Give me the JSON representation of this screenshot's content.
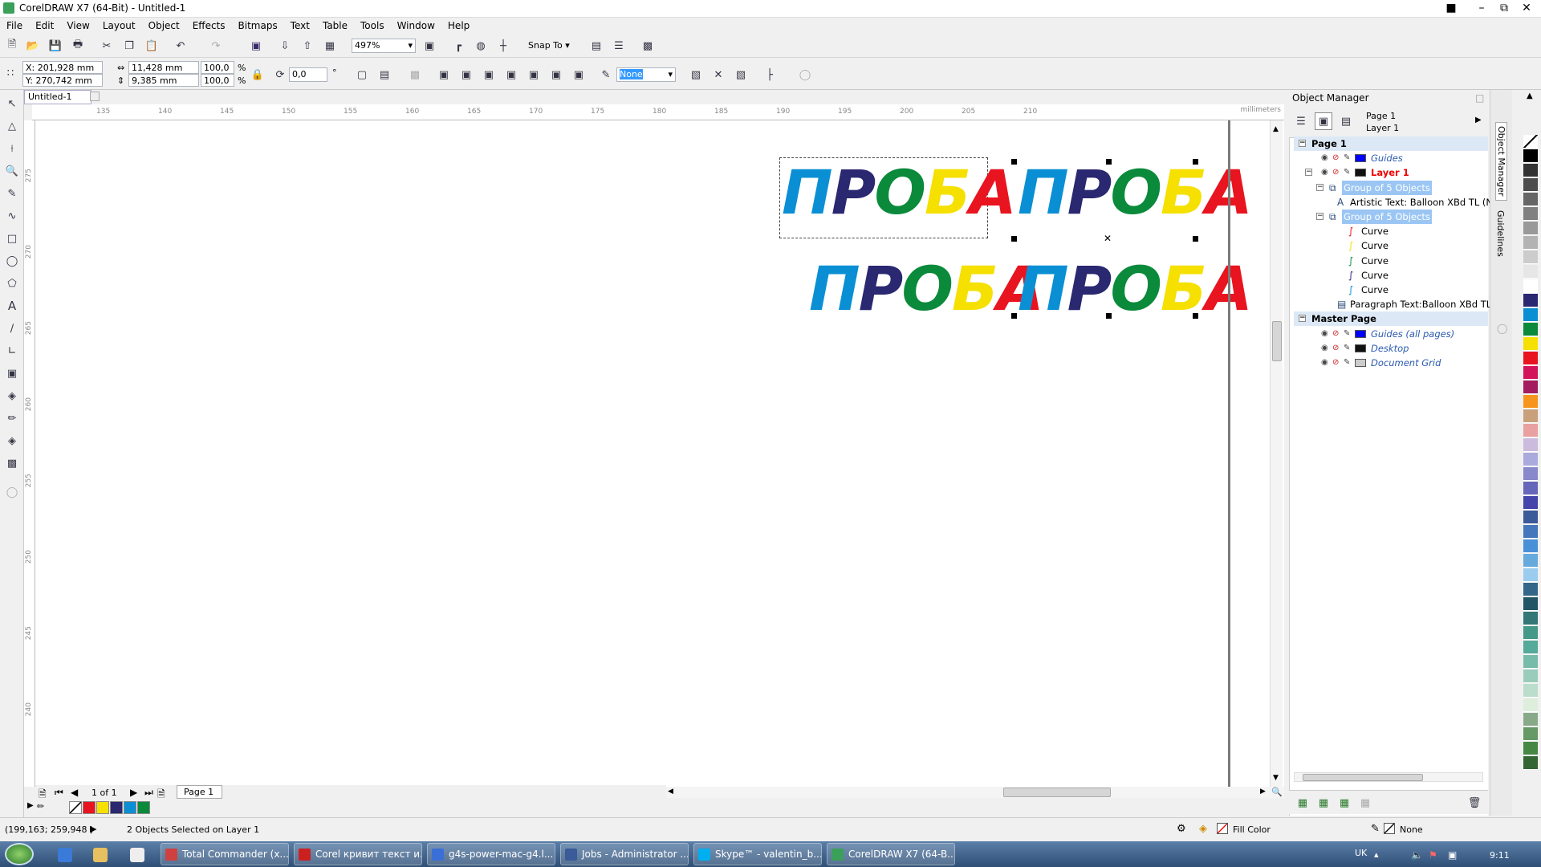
{
  "window": {
    "title": "CorelDRAW X7 (64-Bit) - Untitled-1"
  },
  "menu": [
    "File",
    "Edit",
    "View",
    "Layout",
    "Object",
    "Effects",
    "Bitmaps",
    "Text",
    "Table",
    "Tools",
    "Window",
    "Help"
  ],
  "toolbar": {
    "zoom": "497%",
    "snap_to": "Snap To"
  },
  "propbar": {
    "x": "X: 201,928 mm",
    "y": "Y: 270,742 mm",
    "w": "11,428 mm",
    "h": "9,385 mm",
    "sx": "100,0",
    "sy": "100,0",
    "pct1": "%",
    "pct2": "%",
    "angle": "0,0",
    "deg": "°",
    "outline": "None"
  },
  "doc": {
    "tab": "Untitled-1",
    "ruler_unit": "millimeters"
  },
  "ruler": {
    "h": [
      "135",
      "140",
      "145",
      "150",
      "155",
      "160",
      "165",
      "170",
      "175",
      "180",
      "185",
      "190",
      "195",
      "200",
      "205",
      "210"
    ],
    "v": [
      "275",
      "270",
      "265",
      "260",
      "255",
      "250",
      "245",
      "240"
    ]
  },
  "canvas_text": [
    "ПРОБА",
    "ПРОБА",
    "ПРОБА",
    "ПРОБА"
  ],
  "proba_letters": [
    {
      "ch": "П",
      "color": "#0a8fd4"
    },
    {
      "ch": "Р",
      "color": "#2a2870"
    },
    {
      "ch": "О",
      "color": "#0a8a3a"
    },
    {
      "ch": "Б",
      "color": "#f5e000"
    },
    {
      "ch": "А",
      "color": "#e8141f"
    }
  ],
  "pagenav": {
    "count": "1 of 1",
    "page_tab": "Page 1"
  },
  "status": {
    "coords": "(199,163; 259,948 )",
    "selection": "2 Objects Selected on Layer 1",
    "fill": "Fill Color",
    "outline": "None"
  },
  "object_manager": {
    "title": "Object Manager",
    "header_page": "Page 1",
    "header_layer": "Layer 1",
    "rows": [
      {
        "text": "Page 1",
        "type": "page"
      },
      {
        "text": "Guides",
        "type": "layer",
        "color": "#0000ff",
        "italic": true
      },
      {
        "text": "Layer 1",
        "type": "layer",
        "color": "#111111",
        "red": true
      },
      {
        "text": "Group of 5 Objects",
        "type": "group",
        "sel": true
      },
      {
        "text": "Artistic Text: Balloon XBd TL (N",
        "type": "text"
      },
      {
        "text": "Group of 5 Objects",
        "type": "group",
        "sel": true
      },
      {
        "text": "Curve",
        "type": "curve",
        "color": "#e8141f"
      },
      {
        "text": "Curve",
        "type": "curve",
        "color": "#f5e000"
      },
      {
        "text": "Curve",
        "type": "curve",
        "color": "#0a8a3a"
      },
      {
        "text": "Curve",
        "type": "curve",
        "color": "#2a2870"
      },
      {
        "text": "Curve",
        "type": "curve",
        "color": "#0a8fd4"
      },
      {
        "text": "Paragraph Text:Balloon XBd TL",
        "type": "ptext"
      },
      {
        "text": "Master Page",
        "type": "page"
      },
      {
        "text": "Guides (all pages)",
        "type": "layer",
        "color": "#0000ff",
        "italic": true
      },
      {
        "text": "Desktop",
        "type": "layer",
        "color": "#111111",
        "italic": true
      },
      {
        "text": "Document Grid",
        "type": "layer",
        "color": "#cccccc",
        "italic": true
      }
    ]
  },
  "side_tabs": [
    "Object Manager",
    "Guidelines"
  ],
  "palette_colors": [
    "#ffffff",
    "#000000",
    "#333333",
    "#4d4d4d",
    "#666666",
    "#808080",
    "#999999",
    "#b3b3b3",
    "#cccccc",
    "#e6e6e6",
    "#ffffff",
    "#2a2870",
    "#0a8fd4",
    "#0a8a3a",
    "#f5e000",
    "#e8141f",
    "#d4145a",
    "#a31d5e",
    "#f7941d",
    "#c8a07a",
    "#e8a0a0",
    "#ccbbdd",
    "#aaaadd",
    "#8888cc",
    "#6666bb",
    "#4444aa",
    "#3a5a9a",
    "#4477bb",
    "#4a90d9",
    "#66aadd",
    "#99ccee",
    "#336688",
    "#225566",
    "#337777",
    "#449988",
    "#55aa99",
    "#77bbaa",
    "#99ccbb",
    "#bbddcc",
    "#ddeedd",
    "#88aa88",
    "#669966",
    "#448844",
    "#336633"
  ],
  "bottom_swatches": [
    "#ffffff",
    "#e8141f",
    "#f5e000",
    "#2a2870",
    "#0a8fd4",
    "#0a8a3a"
  ],
  "taskbar": {
    "clock": "9:11",
    "lang": "UK",
    "tasks": [
      {
        "label": "Total Commander (x...",
        "color": "#d04040"
      },
      {
        "label": "Corel кривит текст и...",
        "color": "#cc2020"
      },
      {
        "label": "g4s-power-mac-g4.l...",
        "color": "#3a6fd8"
      },
      {
        "label": "Jobs - Administrator ...",
        "color": "#3a5a9a"
      },
      {
        "label": "Skype™ - valentin_b...",
        "color": "#00aff0"
      },
      {
        "label": "CorelDRAW X7 (64-B...",
        "color": "#3aa05a"
      }
    ]
  }
}
